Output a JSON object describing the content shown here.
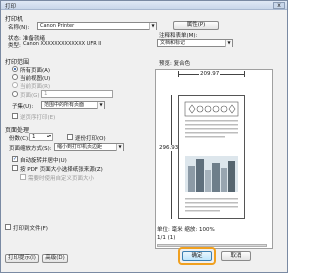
{
  "window": {
    "title": "打印",
    "close": "x"
  },
  "printer": {
    "group": "打印机",
    "name_label": "名称(N):",
    "name_value": "Canon Printer",
    "properties_button": "属性(P)",
    "status_label": "状态:",
    "status_value": "准备就绪",
    "type_label": "类型:",
    "type_value": "Canon XXXXXXXXXXXXX UFR II"
  },
  "comments": {
    "label": "注释和表单(M):",
    "value": "文档和标记"
  },
  "range": {
    "group": "打印范围",
    "all": "所有页面(A)",
    "current_view": "当前视图(U)",
    "current_page": "当前页面(R)",
    "pages": "页面(G)",
    "pages_value": "1",
    "subset_label": "子集(U):",
    "subset_value": "范围中的所有页面",
    "reverse": "逆页序打印(E)"
  },
  "handling": {
    "group": "页面处理",
    "copies_label": "份数(C):",
    "copies_value": "1",
    "collate": "逐份打印(O)",
    "scaling_label": "页面缩放方式(S):",
    "scaling_value": "缩小到打印机页边距",
    "auto_rotate": "自动旋转并居中(U)",
    "pdf_paper": "按 PDF 页面大小选择纸张来源(Z)",
    "custom_paper": "需要时使用自定义页面大小"
  },
  "print_to_file": "打印到文件(F)",
  "preview": {
    "label": "预览: 复合色",
    "width": "209.97",
    "height": "296.93",
    "units": "单位: 毫米 缩放: 100%",
    "page": "1/1 (1)"
  },
  "footer": {
    "tips_button": "打印提示(I)",
    "advanced_button": "高级(D)",
    "ok_button": "确定",
    "cancel_button": "取消"
  }
}
